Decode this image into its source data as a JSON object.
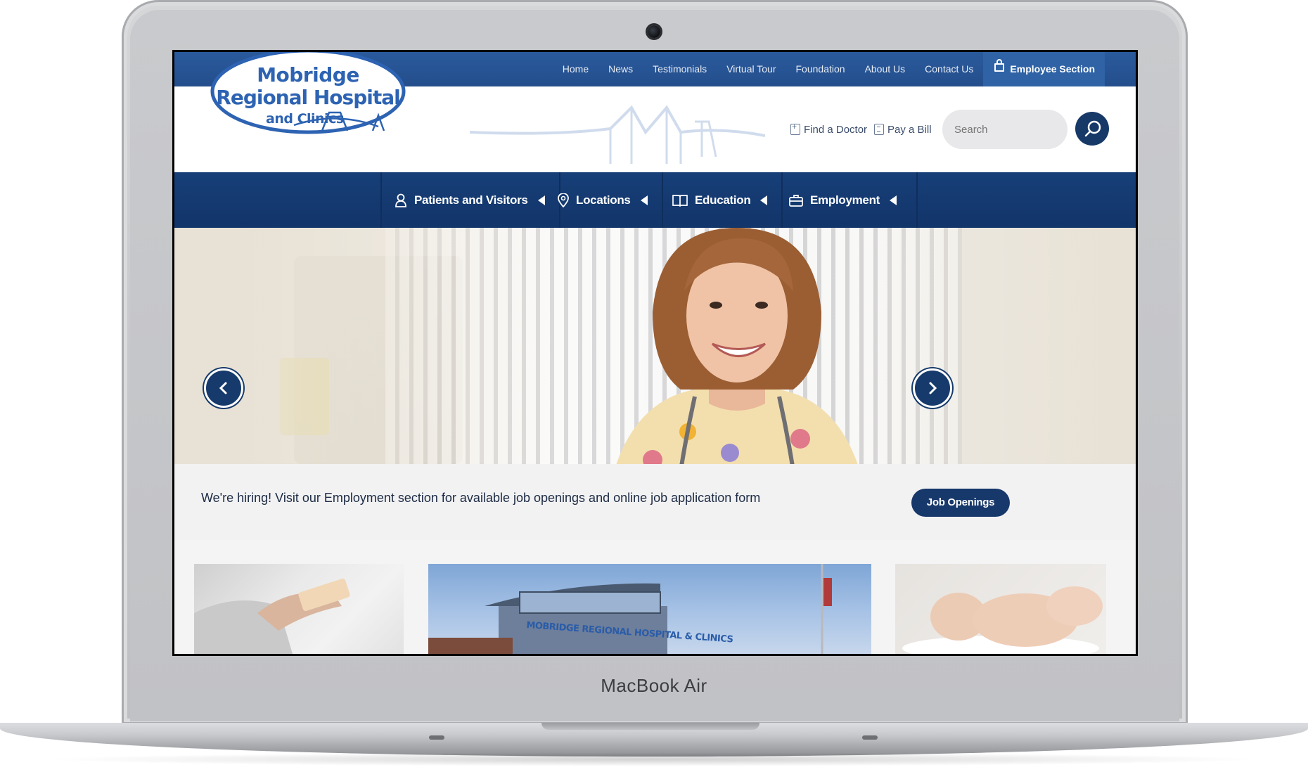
{
  "device": {
    "brand_label": "MacBook Air"
  },
  "top_nav": {
    "items": [
      "Home",
      "News",
      "Testimonials",
      "Virtual Tour",
      "Foundation",
      "About Us",
      "Contact Us"
    ],
    "employee_label": "Employee Section"
  },
  "logo": {
    "line1": "Mobridge",
    "line2": "Regional Hospital",
    "line3": "and Clinics"
  },
  "utility": {
    "find_doctor": "Find a Doctor",
    "pay_bill": "Pay a Bill"
  },
  "search": {
    "placeholder": "Search"
  },
  "main_nav": {
    "items": [
      {
        "label": "Patients and Visitors",
        "icon": "person-icon"
      },
      {
        "label": "Locations",
        "icon": "map-pin-icon"
      },
      {
        "label": "Education",
        "icon": "book-icon"
      },
      {
        "label": "Employment",
        "icon": "briefcase-icon"
      }
    ]
  },
  "hero": {
    "caption": "We're hiring! Visit our Employment section for available job openings and online job application form",
    "cta_label": "Job Openings"
  },
  "cards": {
    "building_sign": "MOBRIDGE REGIONAL HOSPITAL & CLINICS"
  },
  "colors": {
    "nav_blue": "#244e8c",
    "dark_navy": "#17386a",
    "logo_blue": "#2d63b2"
  }
}
